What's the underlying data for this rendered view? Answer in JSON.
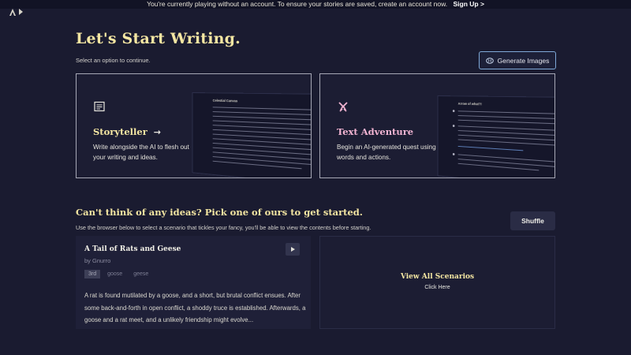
{
  "banner": {
    "message": "You're currently playing without an account. To ensure your stories are saved, create an account now.",
    "signup_label": "Sign Up >"
  },
  "header": {
    "title": "Let's Start Writing.",
    "subtitle": "Select an option to continue.",
    "generate_images_label": "Generate Images"
  },
  "modes": {
    "storyteller": {
      "icon": "document-lines-icon",
      "title": "Storyteller",
      "description": "Write alongside the AI to flesh out your writing and ideas.",
      "preview_title": "Celestial Canvas"
    },
    "adventure": {
      "icon": "crossed-swords-icon",
      "title": "Text Adventure",
      "description": "Begin an AI-generated quest using words and actions.",
      "preview_title": "Arrow of what?!"
    }
  },
  "ideas": {
    "title": "Can't think of any ideas? Pick one of ours to get started.",
    "subtitle": "Use the browser below to select a scenario that tickles your fancy, you'll be able to view the contents before starting.",
    "shuffle_label": "Shuffle"
  },
  "scenario": {
    "title": "A Tail of Rats and Geese",
    "author": "by Gnurro",
    "tags": [
      "3rd",
      "goose",
      "geese"
    ],
    "description": "A rat is found mutilated by a goose, and a short, but brutal conflict ensues. After some back-and-forth in open conflict, a shoddy truce is established. Afterwards, a goose and a rat meet, and a unlikely friendship might evolve..."
  },
  "view_all": {
    "title": "View All Scenarios",
    "subtitle": "Click Here"
  },
  "colors": {
    "background": "#1a1b30",
    "accent_yellow": "#f4e6a2",
    "accent_pink": "#f2b4d2",
    "button_border": "#7fa9d8"
  }
}
